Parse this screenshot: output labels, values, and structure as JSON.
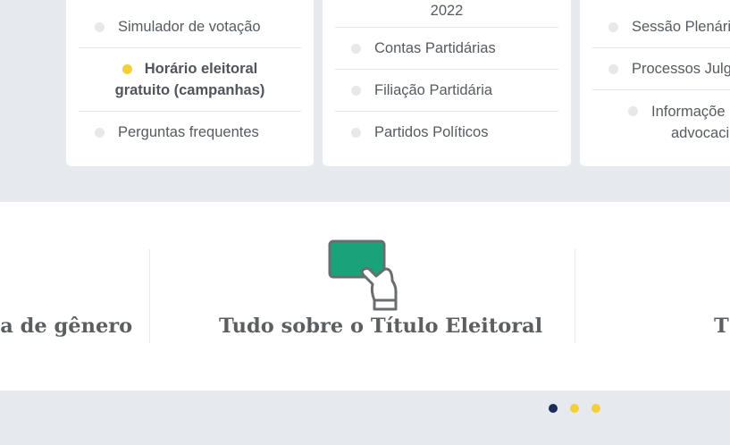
{
  "cards": [
    {
      "items": [
        {
          "label": "Simulador de votação",
          "active": false
        },
        {
          "label": "Horário eleitoral gratuito (campanhas)",
          "line1": "Horário eleitoral",
          "line2": "gratuito (campanhas)",
          "active": true
        },
        {
          "label": "Perguntas frequentes",
          "active": false
        }
      ]
    },
    {
      "items": [
        {
          "label": "2022",
          "active": false
        },
        {
          "label": "Contas Partidárias",
          "active": false
        },
        {
          "label": "Filiação Partidária",
          "active": false
        },
        {
          "label": "Partidos Políticos",
          "active": false
        }
      ]
    },
    {
      "items": [
        {
          "label": "Sessão Plenária",
          "active": false
        },
        {
          "label": "Processos Julga",
          "active": false
        },
        {
          "label": "Informações advocaci",
          "line1": "Informaçõe",
          "line2": "advocaci",
          "active": false
        }
      ]
    }
  ],
  "carousel": {
    "slides": [
      {
        "title": "ica de gênero"
      },
      {
        "title": "Tudo sobre o Título Eleitoral",
        "icon": "voter-id-card-icon"
      },
      {
        "title": "T"
      }
    ],
    "pagination": [
      {
        "label": "slide 1",
        "active": true
      },
      {
        "label": "slide 2",
        "active": false
      },
      {
        "label": "slide 3",
        "active": false
      }
    ]
  },
  "colors": {
    "accent_yellow": "#f5cf3a",
    "active_dot": "#1d2b5a",
    "card_green": "#1aa37a",
    "background": "#e6e9ed"
  }
}
